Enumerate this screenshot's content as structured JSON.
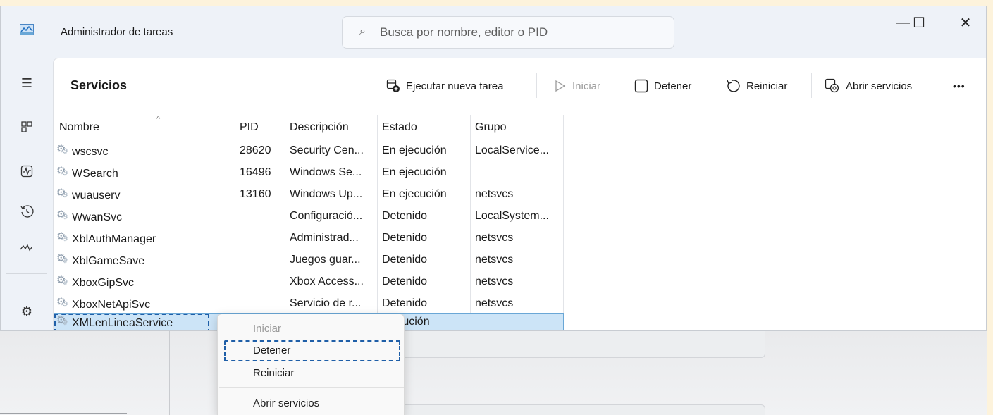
{
  "window": {
    "title": "Administrador de tareas",
    "search_placeholder": "Busca por nombre, editor o PID",
    "controls": {
      "minimize": "—",
      "maximize": "☐",
      "close": "✕"
    }
  },
  "sidebar": {
    "items": [
      {
        "name": "menu",
        "glyph": "☰"
      },
      {
        "name": "processes",
        "glyph": "⊞"
      },
      {
        "name": "performance",
        "glyph": "📈"
      },
      {
        "name": "history",
        "glyph": "⟲"
      },
      {
        "name": "startup",
        "glyph": "〰"
      },
      {
        "name": "settings",
        "glyph": "⚙"
      }
    ]
  },
  "panel": {
    "title": "Servicios",
    "toolbar": {
      "run_task": "Ejecutar nueva tarea",
      "start": "Iniciar",
      "stop": "Detener",
      "restart": "Reiniciar",
      "open_services": "Abrir servicios",
      "more": "•••"
    }
  },
  "table": {
    "sort_indicator": "^",
    "columns": [
      "Nombre",
      "PID",
      "Descripción",
      "Estado",
      "Grupo"
    ],
    "rows": [
      {
        "name": "wscsvc",
        "pid": "28620",
        "desc": "Security Cen...",
        "status": "En ejecución",
        "group": "LocalService..."
      },
      {
        "name": "WSearch",
        "pid": "16496",
        "desc": "Windows Se...",
        "status": "En ejecución",
        "group": ""
      },
      {
        "name": "wuauserv",
        "pid": "13160",
        "desc": "Windows Up...",
        "status": "En ejecución",
        "group": "netsvcs"
      },
      {
        "name": "WwanSvc",
        "pid": "",
        "desc": "Configuració...",
        "status": "Detenido",
        "group": "LocalSystem..."
      },
      {
        "name": "XblAuthManager",
        "pid": "",
        "desc": "Administrad...",
        "status": "Detenido",
        "group": "netsvcs"
      },
      {
        "name": "XblGameSave",
        "pid": "",
        "desc": "Juegos guar...",
        "status": "Detenido",
        "group": "netsvcs"
      },
      {
        "name": "XboxGipSvc",
        "pid": "",
        "desc": "Xbox Access...",
        "status": "Detenido",
        "group": "netsvcs"
      },
      {
        "name": "XboxNetApiSvc",
        "pid": "",
        "desc": "Servicio de r...",
        "status": "Detenido",
        "group": "netsvcs"
      },
      {
        "name": "XMLenLineaService",
        "pid": "",
        "desc": "",
        "status": "ejecución",
        "group": ""
      }
    ]
  },
  "context_menu": {
    "items": [
      "Iniciar",
      "Detener",
      "Reiniciar",
      "Abrir servicios"
    ]
  },
  "colors": {
    "selection": "#cce4f7",
    "focus": "#1f5fa8",
    "accent": "#6aa7d6"
  }
}
